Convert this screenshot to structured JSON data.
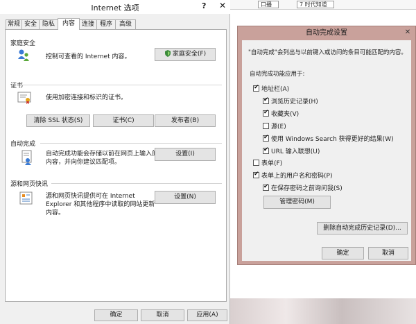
{
  "internet_options": {
    "title": "Internet 选项",
    "help": "?",
    "close": "✕",
    "tabs": [
      "常规",
      "安全",
      "隐私",
      "内容",
      "连接",
      "程序",
      "高级"
    ],
    "family_safety": {
      "heading": "家庭安全",
      "description": "控制可查看的 Internet 内容。",
      "button": "家庭安全(F)",
      "icon": "family-safety-icon"
    },
    "certificates": {
      "heading": "证书",
      "description": "使用加密连接和标识的证书。",
      "buttons": [
        "清除 SSL 状态(S)",
        "证书(C)",
        "发布者(B)"
      ],
      "icon": "certificate-icon"
    },
    "autocomplete": {
      "heading": "自动完成",
      "description_line1": "自动完成功能会存储以前在网页上输入的",
      "description_line2": "内容，并向你建议匹配项。",
      "button": "设置(I)",
      "icon": "autocomplete-icon"
    },
    "feeds": {
      "heading": "源和网页快讯",
      "description_line1": "源和网页快讯提供可在 Internet",
      "description_line2": "Explorer 和其他程序中读取的网站更新",
      "description_line3": "内容。",
      "button": "设置(N)",
      "icon": "feeds-icon"
    },
    "footer": {
      "ok": "确定",
      "cancel": "取消",
      "apply": "应用(A)"
    }
  },
  "autocomplete_settings": {
    "title": "自动完成设置",
    "close": "✕",
    "intro": "\"自动完成\"会列出与以前键入或访问的条目可能匹配的内容。",
    "group_label": "自动完成功能应用于:",
    "options": [
      {
        "label": "地址栏(A)",
        "checked": true
      },
      {
        "label": "浏览历史记录(H)",
        "checked": true
      },
      {
        "label": "收藏夹(V)",
        "checked": true
      },
      {
        "label": "源(E)",
        "checked": false
      },
      {
        "label": "使用 Windows Search 获得更好的结果(W)",
        "checked": true
      },
      {
        "label": "URL 输入联想(U)",
        "checked": true
      },
      {
        "label": "表单(F)",
        "checked": false
      },
      {
        "label": "表单上的用户名和密码(P)",
        "checked": true
      },
      {
        "label": "在保存密码之前询问我(S)",
        "checked": true
      }
    ],
    "manage_passwords": "管理密码(M)",
    "delete_history": "删除自动完成历史记录(D)...",
    "ok": "确定",
    "cancel": "取消"
  },
  "background": {
    "tab_label": "口播",
    "tab2_label": "7 时代知道"
  }
}
